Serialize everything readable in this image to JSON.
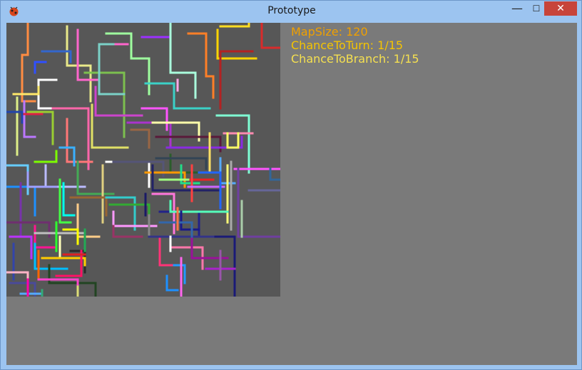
{
  "window": {
    "title": "Prototype"
  },
  "caption_buttons": {
    "minimize": "—",
    "maximize": "☐",
    "close": "✕"
  },
  "info": {
    "map_size": "MapSize: 120",
    "chance_to_turn": "ChanceToTurn: 1/15",
    "chance_to_branch": "ChanceToBranch: 1/15"
  },
  "colors": {
    "map_background": "#575757",
    "client_background": "#7a7a7a",
    "info_primary": "#f0a000",
    "info_secondary": "#f5e050",
    "close_button": "#c7443a"
  },
  "icons": {
    "app": "bug-icon"
  }
}
